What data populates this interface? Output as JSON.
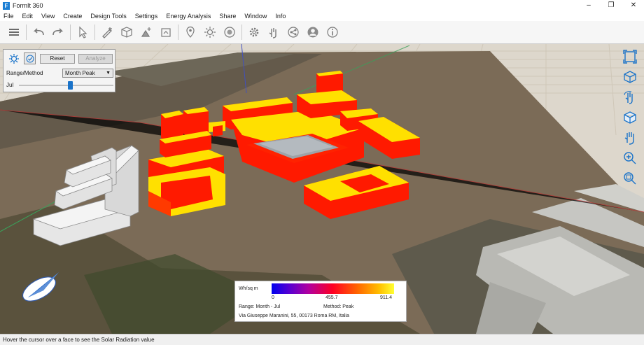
{
  "window": {
    "title": "FormIt 360",
    "icon_letter": "F",
    "minimize": "–",
    "restore": "❐",
    "close": "✕"
  },
  "menu": [
    "File",
    "Edit",
    "View",
    "Create",
    "Design Tools",
    "Settings",
    "Energy Analysis",
    "Share",
    "Window",
    "Info"
  ],
  "toolbar_icons": [
    "menu-icon",
    "undo-icon",
    "redo-icon",
    "select-icon",
    "sketch-icon",
    "cube-icon",
    "add-object-icon",
    "import-icon",
    "location-icon",
    "sun-icon",
    "solar-icon",
    "settings-icon",
    "gesture-icon",
    "share-icon",
    "account-icon",
    "info-icon"
  ],
  "solar_panel": {
    "reset_label": "Reset",
    "analyze_label": "Analyze",
    "range_method_label": "Range/Method",
    "range_method_value": "Month Peak",
    "month_label": "Jul",
    "slider_position_fraction": 0.54
  },
  "nav_tools": [
    "zoom-extents-icon",
    "view-cube-icon",
    "orbit-icon",
    "view-icon",
    "pan-icon",
    "zoom-in-icon",
    "zoom-window-icon"
  ],
  "legend": {
    "unit_label": "Wh/sq m",
    "min_label": "0",
    "mid_label": "455.7",
    "max_label": "911.4",
    "range_text": "Range: Month - Jul",
    "method_text": "Method: Peak",
    "address": "Via Giuseppe Maranini, 55, 00173 Roma RM, Italia"
  },
  "status_text": "Hover the cursor over a face to see the Solar Radiation value",
  "colors": {
    "accent": "#1a73c9",
    "building_red": "#ff1a00",
    "building_yellow": "#ffe000",
    "context_gray": "#e8e8e8"
  }
}
